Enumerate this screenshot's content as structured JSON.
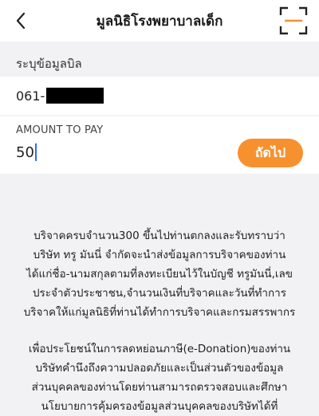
{
  "header": {
    "title": "มูลนิธิโรงพยาบาลเด็ก",
    "back_icon": "chevron-left-icon",
    "scan_icon": "scan-frame-icon"
  },
  "bill": {
    "section_label": "ระบุข้อมูลบิล",
    "bill_number_prefix": "061-",
    "bill_number_redacted": true
  },
  "amount": {
    "label": "AMOUNT TO PAY",
    "value": "50"
  },
  "next_button": {
    "label": "ถัดไป",
    "color": "#f7912e"
  },
  "info": {
    "paragraph1": [
      "บริจาคครบจำนวน300 ขึ้นไปท่านตกลงและรับทราบว่า",
      "บริษัท ทรู มันนี่ จำกัดจะนำส่งข้อมูลการบริจาคของท่าน",
      "ได้แก่ชื่อ-นามสกุลตามที่ลงทะเบียนไว้ในบัญชี ทรูมันนี่,เลข",
      "ประจำตัวประชาชน,จำนวนเงินที่บริจาคและวันที่ทำการ",
      "บริจาคให้แก่มูลนิธิที่ท่านได้ทำการบริจาคและกรมสรรพากร"
    ],
    "paragraph2": [
      "เพื่อประโยชน์ในการลดหย่อนภาษี(e-Donation)ของท่าน",
      "บริษัทคำนึงถึงความปลอดภัยและเป็นส่วนตัวของข้อมูล",
      "ส่วนบุคคลของท่านโดยท่านสามารถตรวจสอบและศึกษา",
      "นโยบายการคุ้มครองข้อมูลส่วนบุคคลของบริษัทได้ที่"
    ]
  }
}
